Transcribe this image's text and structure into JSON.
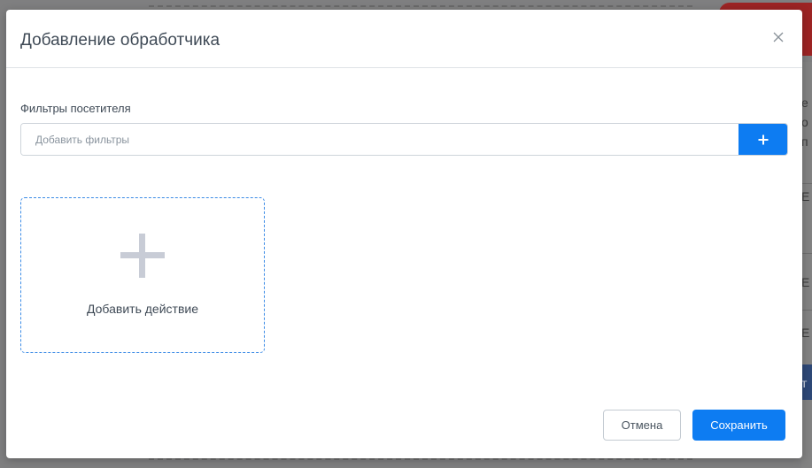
{
  "modal": {
    "title": "Добавление обработчика",
    "filters_label": "Фильтры посетителя",
    "filters_placeholder": "Добавить фильтры",
    "add_action_label": "Добавить действие",
    "cancel_label": "Отмена",
    "save_label": "Сохранить"
  },
  "background": {
    "right_text": [
      "е",
      "о",
      "п",
      "Е",
      "Е",
      "Е",
      "т"
    ]
  },
  "colors": {
    "accent": "#0d7cf2",
    "dashed_border": "#3b8be6",
    "plus_icon": "#c8ccd6"
  },
  "icons": {
    "close": "close-icon",
    "add_filter": "plus-icon",
    "add_action": "plus-icon"
  }
}
